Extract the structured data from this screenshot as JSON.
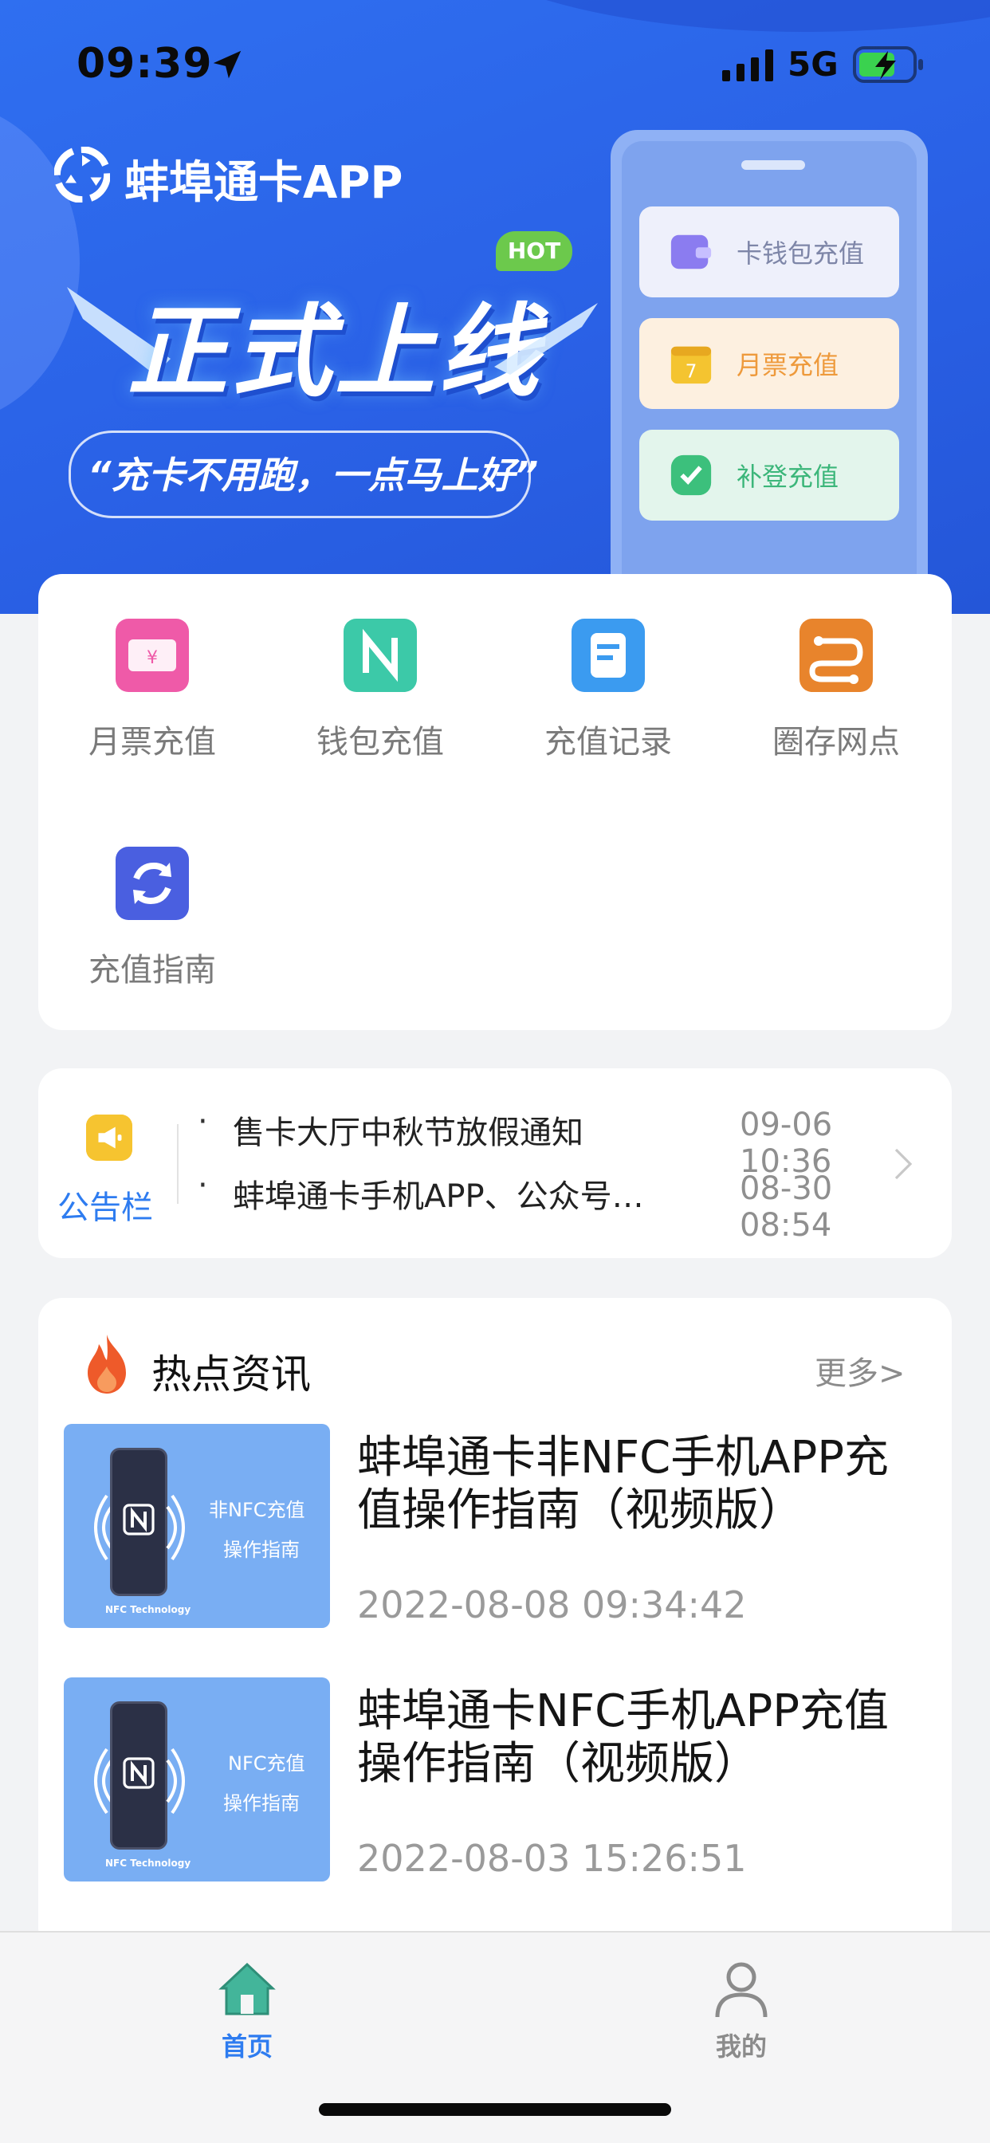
{
  "status_bar": {
    "time": "09:39",
    "network": "5G",
    "icons": [
      "location-arrow-icon",
      "signal-icon",
      "battery-charging-icon"
    ]
  },
  "banner": {
    "app_title": "蚌埠通卡APP",
    "hot_badge": "HOT",
    "headline": "正式上线",
    "slogan": "“充卡不用跑，一点马上好”",
    "phone_cards": [
      {
        "label": "卡钱包充值",
        "icon": "wallet-icon",
        "color": "#8b7cf0"
      },
      {
        "label": "月票充值",
        "icon": "calendar-icon",
        "color": "#f4c430"
      },
      {
        "label": "补登充值",
        "icon": "check-icon",
        "color": "#3cc07c"
      }
    ]
  },
  "menu": {
    "items": [
      {
        "label": "月票充值",
        "icon": "ticket-icon",
        "color": "#ef5aa8"
      },
      {
        "label": "钱包充值",
        "icon": "nfc-icon",
        "color": "#3cc9a8"
      },
      {
        "label": "充值记录",
        "icon": "record-icon",
        "color": "#3b9bf0"
      },
      {
        "label": "圈存网点",
        "icon": "route-icon",
        "color": "#e8842c"
      },
      {
        "label": "充值指南",
        "icon": "refresh-icon",
        "color": "#4a5fe0"
      }
    ]
  },
  "notice": {
    "label": "公告栏",
    "items": [
      {
        "bullet": "·",
        "title": "售卡大厅中秋节放假通知",
        "time": "09-06 10:36"
      },
      {
        "bullet": "·",
        "title": "蚌埠通卡手机APP、公众号…",
        "time": "08-30 08:54"
      }
    ]
  },
  "news": {
    "title": "热点资讯",
    "more": "更多>",
    "items": [
      {
        "headline": "蚌埠通卡非NFC手机APP充值操作指南（视频版）",
        "date": "2022-08-08 09:34:42",
        "thumb_line1": "非NFC充值",
        "thumb_line2": "操作指南",
        "thumb_small": "NFC Technology"
      },
      {
        "headline": "蚌埠通卡NFC手机APP充值操作指南（视频版）",
        "date": "2022-08-03 15:26:51",
        "thumb_line1": "NFC充值",
        "thumb_line2": "操作指南",
        "thumb_small": "NFC Technology"
      }
    ]
  },
  "tabbar": {
    "tabs": [
      {
        "label": "首页",
        "icon": "home-icon",
        "active": true,
        "color": "#2e7cf0"
      },
      {
        "label": "我的",
        "icon": "user-icon",
        "active": false,
        "color": "#8b8b8b"
      }
    ]
  }
}
